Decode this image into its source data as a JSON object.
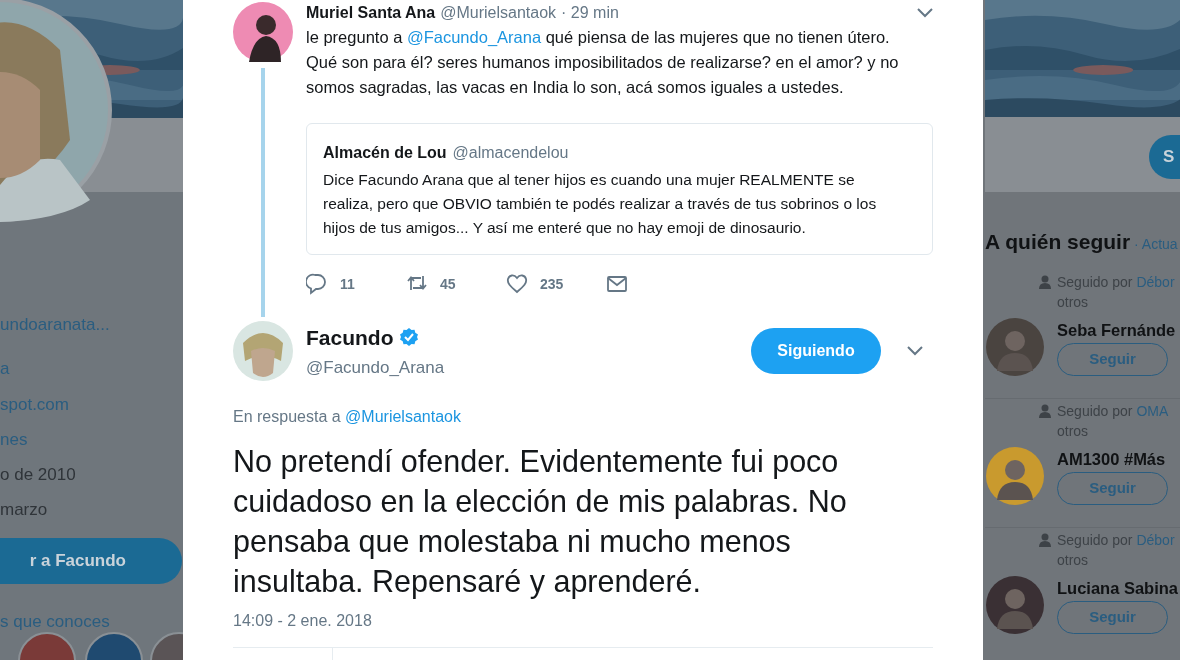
{
  "profile_sidebar": {
    "items": [
      {
        "text": "undoaranata...",
        "kind": "link"
      },
      {
        "text": "a",
        "kind": "link"
      },
      {
        "text": "spot.com",
        "kind": "link"
      },
      {
        "text": "nes",
        "kind": "link"
      },
      {
        "text": "o de 2010",
        "kind": "text"
      },
      {
        "text": "marzo",
        "kind": "text"
      }
    ],
    "message_button": "r a Facundo",
    "followers_you_know": "s que conoces"
  },
  "modal": {
    "parent_tweet": {
      "name": "Muriel Santa Ana",
      "handle": "@Murielsantaok",
      "time": "· 29 min",
      "text_parts": [
        {
          "text": "le pregunto a ",
          "kind": "plain"
        },
        {
          "text": "@Facundo_Arana",
          "kind": "mention"
        },
        {
          "text": " qué piensa de las mujeres que no tienen útero. Qué son para él? seres humanos imposibilitados de realizarse? en el amor? y no somos sagradas, las vacas en India lo son, acá somos iguales a ustedes.",
          "kind": "plain"
        }
      ],
      "quoted": {
        "name": "Almacén de Lou",
        "handle": "@almacendelou",
        "text": "Dice Facundo Arana que al tener hijos es cuando una mujer REALMENTE se realiza, pero que OBVIO también te podés realizar a través de tus sobrinos o los hijos de tus amigos... Y así me enteré que no hay emoji de dinosaurio."
      },
      "actions": [
        {
          "kind": "reply",
          "count": "11"
        },
        {
          "kind": "retweet",
          "count": "45"
        },
        {
          "kind": "like",
          "count": "235"
        },
        {
          "kind": "message"
        }
      ]
    },
    "tweet": {
      "name": "Facundo",
      "verified": true,
      "handle": "@Facundo_Arana",
      "follow_button": "Siguiendo",
      "reply_prefix": "En respuesta a",
      "reply_to": "@Murielsantaok",
      "text": "No pretendí ofender. Evidentemente fui poco cuidadoso en la elección de mis palabras. No pensaba que molestaba ni mucho menos insultaba. Repensaré y aprenderé.",
      "timestamp": "14:09 - 2 ene. 2018"
    }
  },
  "who_to_follow": {
    "header_button": "S",
    "title": "A quién seguir",
    "refresh": "· Actua",
    "suggestions": [
      {
        "prefix": "Seguido por",
        "by": "Débor",
        "suffix": "otros",
        "name": "Seba Fernánde",
        "button": "Seguir"
      },
      {
        "prefix": "Seguido por",
        "by": "OMA",
        "suffix": "otros",
        "name": "AM1300 #Más",
        "button": "Seguir"
      },
      {
        "prefix": "Seguido por",
        "by": "Débor",
        "suffix": "otros",
        "name": "Luciana Sabina",
        "button": "Seguir"
      }
    ]
  }
}
